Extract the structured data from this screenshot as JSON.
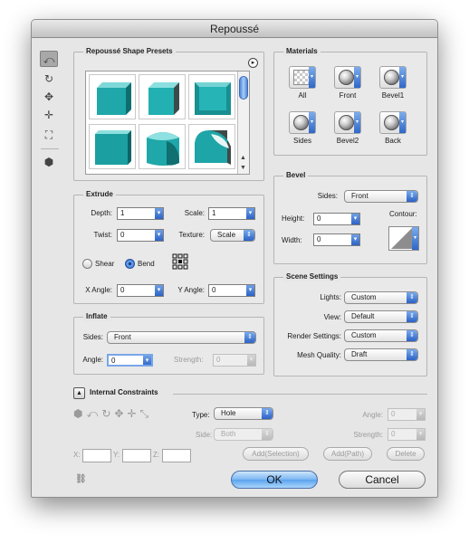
{
  "window": {
    "title": "Repoussé"
  },
  "presets": {
    "title": "Repoussé Shape Presets",
    "menu_icon": "play-circle-icon"
  },
  "materials": {
    "title": "Materials",
    "items": [
      {
        "label": "All",
        "kind": "checker"
      },
      {
        "label": "Front",
        "kind": "sphere"
      },
      {
        "label": "Bevel1",
        "kind": "sphere"
      },
      {
        "label": "Sides",
        "kind": "sphere"
      },
      {
        "label": "Bevel2",
        "kind": "sphere"
      },
      {
        "label": "Back",
        "kind": "sphere"
      }
    ]
  },
  "extrude": {
    "title": "Extrude",
    "depth_label": "Depth:",
    "depth_value": "1",
    "scale_label": "Scale:",
    "scale_value": "1",
    "twist_label": "Twist:",
    "twist_value": "0",
    "texture_label": "Texture:",
    "texture_value": "Scale",
    "shear_label": "Shear",
    "bend_label": "Bend",
    "selected_mode": "Bend",
    "xangle_label": "X Angle:",
    "xangle_value": "0",
    "yangle_label": "Y Angle:",
    "yangle_value": "0"
  },
  "bevel": {
    "title": "Bevel",
    "sides_label": "Sides:",
    "sides_value": "Front",
    "height_label": "Height:",
    "height_value": "0",
    "width_label": "Width:",
    "width_value": "0",
    "contour_label": "Contour:"
  },
  "inflate": {
    "title": "Inflate",
    "sides_label": "Sides:",
    "sides_value": "Front",
    "angle_label": "Angle:",
    "angle_value": "0",
    "strength_label": "Strength:",
    "strength_value": "0"
  },
  "scene": {
    "title": "Scene Settings",
    "lights_label": "Lights:",
    "lights_value": "Custom",
    "view_label": "View:",
    "view_value": "Default",
    "render_label": "Render Settings:",
    "render_value": "Custom",
    "mesh_label": "Mesh Quality:",
    "mesh_value": "Draft"
  },
  "constraints": {
    "title": "Internal Constraints",
    "type_label": "Type:",
    "type_value": "Hole",
    "side_label": "Side:",
    "side_value": "Both",
    "angle_label": "Angle:",
    "angle_value": "0",
    "strength_label": "Strength:",
    "strength_value": "0",
    "x_label": "X:",
    "y_label": "Y:",
    "z_label": "Z:",
    "add_selection_label": "Add(Selection)",
    "add_path_label": "Add(Path)",
    "delete_label": "Delete"
  },
  "buttons": {
    "ok_label": "OK",
    "cancel_label": "Cancel"
  },
  "colors": {
    "teal": "#1fa7a9",
    "accent_blue": "#2c62c6"
  }
}
